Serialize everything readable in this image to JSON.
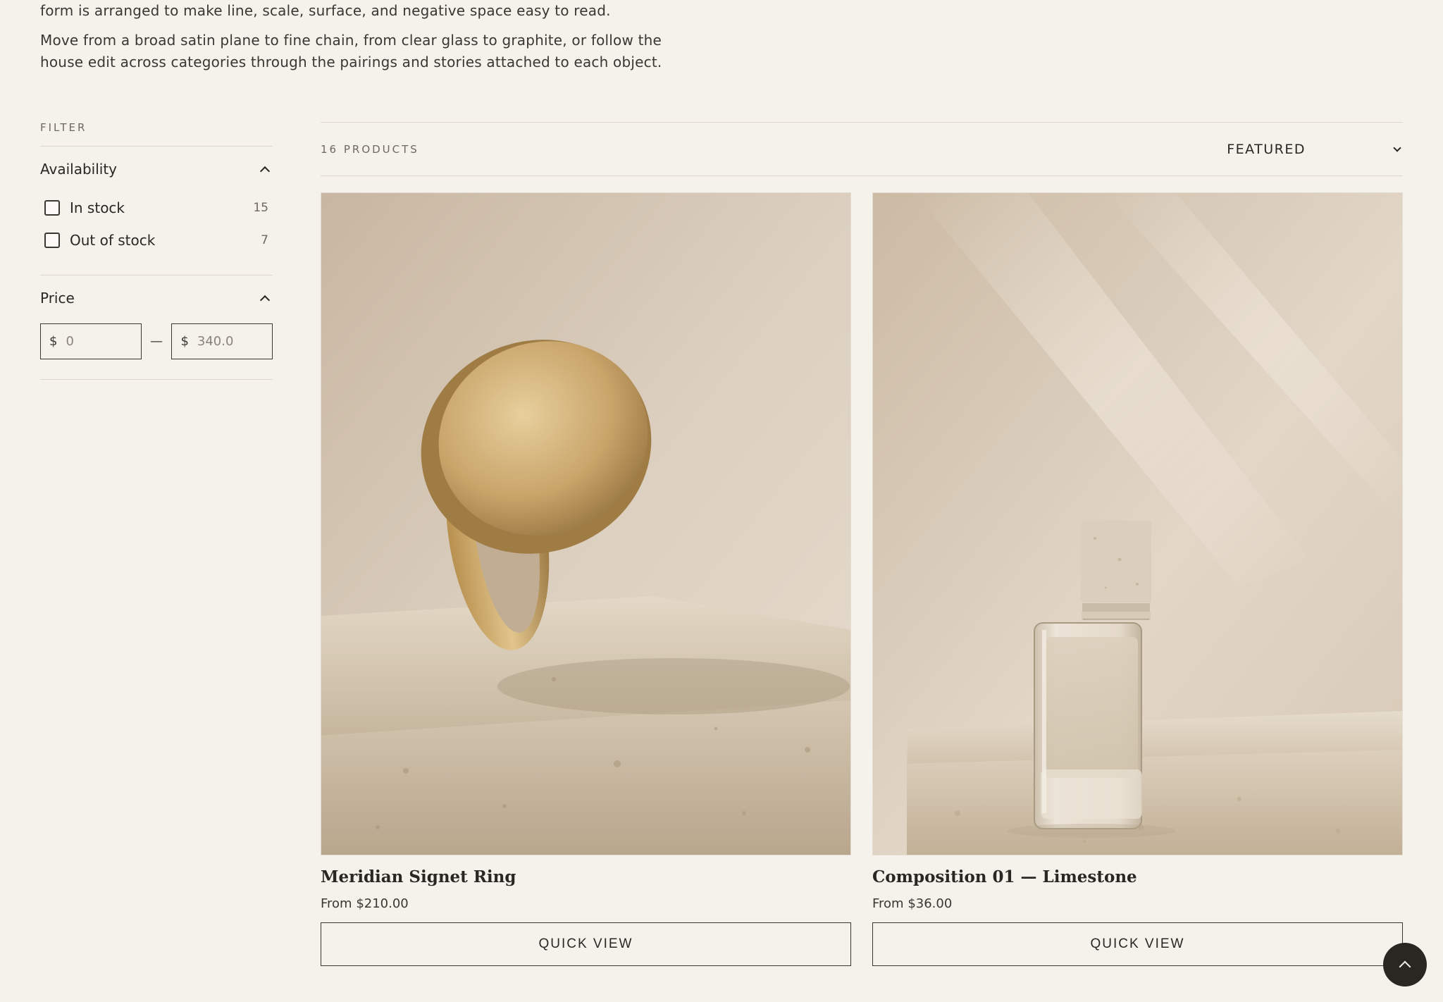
{
  "intro": {
    "line1": "form is arranged to make line, scale, surface, and negative space easy to read.",
    "line2": "Move from a broad satin plane to fine chain, from clear glass to graphite, or follow the house edit across categories through the pairings and stories attached to each object."
  },
  "filter": {
    "heading": "FILTER",
    "availability": {
      "label": "Availability",
      "options": [
        {
          "label": "In stock",
          "count": "15"
        },
        {
          "label": "Out of stock",
          "count": "7"
        }
      ]
    },
    "price": {
      "label": "Price",
      "currency": "$",
      "min_placeholder": "0",
      "max_placeholder": "340.0",
      "separator": "—"
    }
  },
  "toolbar": {
    "count": "16 PRODUCTS",
    "sort_label": "FEATURED"
  },
  "products": [
    {
      "name": "Meridian Signet Ring",
      "price": "From $210.00",
      "cta": "QUICK VIEW"
    },
    {
      "name": "Composition 01 — Limestone",
      "price": "From $36.00",
      "cta": "QUICK VIEW"
    }
  ],
  "icons": {
    "availability_toggle": "chevron-up-icon",
    "price_toggle": "chevron-up-icon",
    "sort": "chevron-down-icon",
    "back_to_top": "arrow-up-icon"
  },
  "colors": {
    "background": "#f5f1eb",
    "text": "#2a2723",
    "button_dark": "#2a2723"
  }
}
